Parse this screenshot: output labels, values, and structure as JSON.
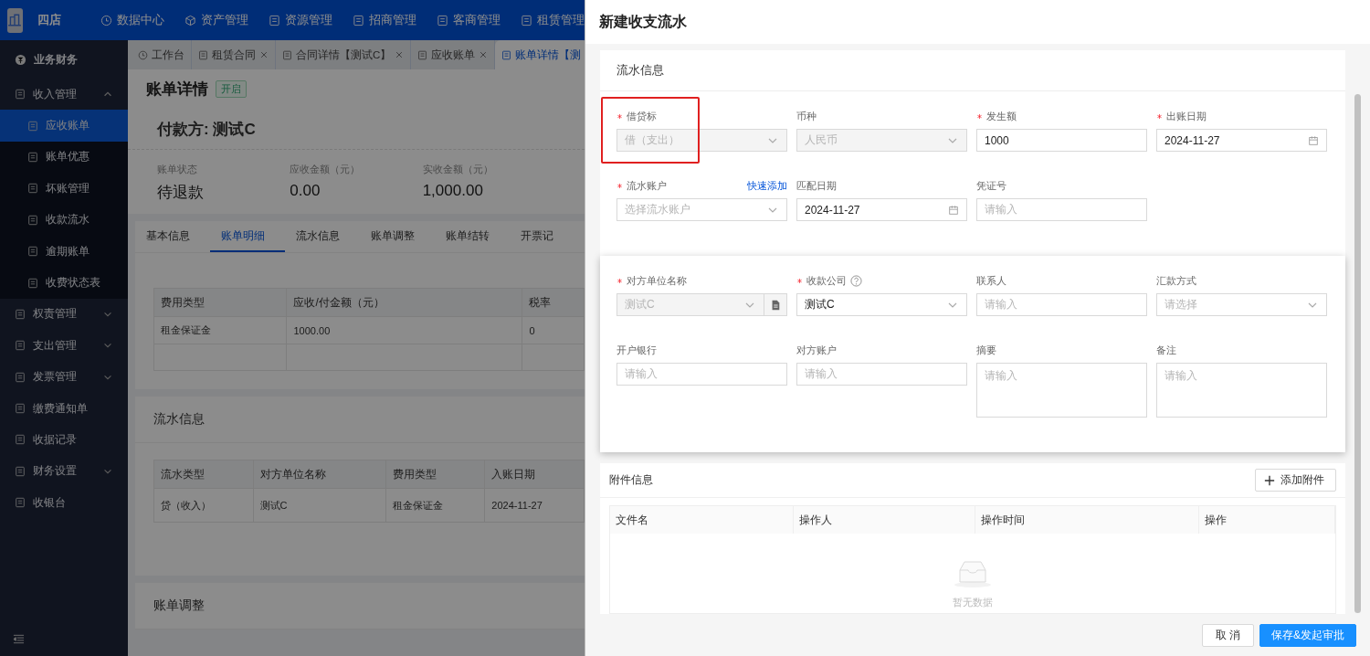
{
  "topbar": {
    "brand": "四店",
    "nav": [
      "数据中心",
      "资产管理",
      "资源管理",
      "招商管理",
      "客商管理",
      "租赁管理"
    ]
  },
  "sidebar": {
    "items": [
      {
        "label": "业务财务",
        "kind": "header"
      },
      {
        "label": "收入管理",
        "kind": "group",
        "expanded": true,
        "children": [
          {
            "label": "应收账单",
            "selected": true
          },
          {
            "label": "账单优惠",
            "selected": false
          },
          {
            "label": "坏账管理",
            "selected": false
          },
          {
            "label": "收款流水",
            "selected": false
          },
          {
            "label": "逾期账单",
            "selected": false
          },
          {
            "label": "收费状态表",
            "selected": false
          }
        ]
      },
      {
        "label": "权责管理",
        "kind": "group",
        "expanded": false
      },
      {
        "label": "支出管理",
        "kind": "group",
        "expanded": false
      },
      {
        "label": "发票管理",
        "kind": "group",
        "expanded": false
      },
      {
        "label": "缴费通知单",
        "kind": "item",
        "selected": false
      },
      {
        "label": "收据记录",
        "kind": "item",
        "selected": false
      },
      {
        "label": "财务设置",
        "kind": "group",
        "expanded": false
      },
      {
        "label": "收银台",
        "kind": "item",
        "selected": false
      }
    ]
  },
  "page_tabs": [
    {
      "label": "工作台",
      "selected": false
    },
    {
      "label": "租赁合同",
      "closable": true,
      "selected": false
    },
    {
      "label": "合同详情【测试C】",
      "closable": true,
      "selected": false
    },
    {
      "label": "应收账单",
      "closable": true,
      "selected": false
    },
    {
      "label": "账单详情【测",
      "selected": true
    }
  ],
  "bill": {
    "title": "账单详情",
    "status_badge": "开启",
    "payer": "付款方: 测试C",
    "stats": [
      {
        "label": "账单状态",
        "value": "待退款"
      },
      {
        "label": "应收金额（元）",
        "value": "0.00"
      },
      {
        "label": "实收金额（元）",
        "value": "1,000.00"
      }
    ]
  },
  "detail_tabs": [
    {
      "label": "基本信息",
      "selected": false
    },
    {
      "label": "账单明细",
      "selected": true
    },
    {
      "label": "流水信息",
      "selected": false
    },
    {
      "label": "账单调整",
      "selected": false
    },
    {
      "label": "账单结转",
      "selected": false
    },
    {
      "label": "开票记",
      "selected": false
    }
  ],
  "fee_table": {
    "columns": [
      "费用类型",
      "应收/付金额（元）",
      "税率"
    ],
    "rows": [
      [
        "租金保证金",
        "1000.00",
        "0"
      ]
    ]
  },
  "flow_section": {
    "title": "流水信息",
    "columns": [
      "流水类型",
      "对方单位名称",
      "费用类型",
      "入账日期"
    ],
    "rows": [
      [
        "贷（收入）",
        "测试C",
        "租金保证金",
        "2024-11-27"
      ]
    ]
  },
  "adjust_section": {
    "title": "账单调整"
  },
  "drawer": {
    "title": "新建收支流水",
    "sections": [
      {
        "title": "流水信息",
        "fields": [
          {
            "label": "借贷标",
            "required": true,
            "kind": "select",
            "value": "借（支出）",
            "disabled": true,
            "highlighted": true
          },
          {
            "label": "币种",
            "kind": "select",
            "value": "人民币",
            "disabled": true
          },
          {
            "label": "发生额",
            "required": true,
            "kind": "input",
            "value": "1000"
          },
          {
            "label": "出账日期",
            "required": true,
            "kind": "date",
            "value": "2024-11-27"
          },
          {
            "label": "流水账户",
            "required": true,
            "kind": "select",
            "placeholder": "选择流水账户",
            "action": "快速添加"
          },
          {
            "label": "匹配日期",
            "kind": "date",
            "value": "2024-11-27"
          },
          {
            "label": "凭证号",
            "kind": "input",
            "placeholder": "请输入"
          }
        ]
      },
      {
        "fields": [
          {
            "label": "对方单位名称",
            "required": true,
            "kind": "select-addon",
            "value": "测试C",
            "disabled": true
          },
          {
            "label": "收款公司",
            "required": true,
            "kind": "select",
            "value": "测试C",
            "help": true
          },
          {
            "label": "联系人",
            "kind": "input",
            "placeholder": "请输入"
          },
          {
            "label": "汇款方式",
            "kind": "select",
            "placeholder": "请选择"
          },
          {
            "label": "开户银行",
            "kind": "input",
            "placeholder": "请输入"
          },
          {
            "label": "对方账户",
            "kind": "input",
            "placeholder": "请输入"
          },
          {
            "label": "摘要",
            "kind": "textarea",
            "placeholder": "请输入"
          },
          {
            "label": "备注",
            "kind": "textarea",
            "placeholder": "请输入"
          }
        ]
      }
    ],
    "attachments": {
      "title": "附件信息",
      "add_button": "添加附件",
      "columns": [
        "文件名",
        "操作人",
        "操作时间",
        "操作"
      ],
      "empty_text": "暂无数据"
    },
    "buttons": [
      {
        "label": "取 消",
        "kind": "default"
      },
      {
        "label": "保存&发起审批",
        "kind": "primary"
      }
    ]
  }
}
